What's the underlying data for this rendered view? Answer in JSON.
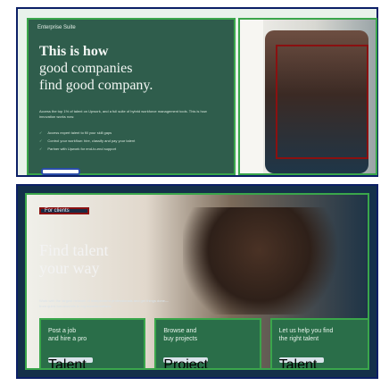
{
  "top_card": {
    "tag": "Enterprise Suite",
    "headline_lines": [
      "This is how",
      "good companies",
      "find good company."
    ],
    "description": "Access the top 1% of talent on Upwork, and a full suite of hybrid workforce management tools. This is how innovation works now.",
    "bullets": [
      "Access expert talent to fill your skill gaps",
      "Control your workflow: hire, classify and pay your talent",
      "Partner with Upwork for end-to-end support"
    ],
    "cta": ""
  },
  "bottom_card": {
    "tag": "For clients",
    "headline_lines": [
      "Find talent",
      "your way"
    ],
    "description": "Work with the largest network of independent professionals and get things done—from quick turnarounds to big transformations.",
    "cards": [
      {
        "title_lines": [
          "Post a job",
          "and hire a pro"
        ],
        "link": "Talent Marketplace"
      },
      {
        "title_lines": [
          "Browse and",
          "buy projects"
        ],
        "link": "Project Catalog"
      },
      {
        "title_lines": [
          "Let us help you find",
          "the right talent"
        ],
        "link": "Talent Scout"
      }
    ]
  }
}
